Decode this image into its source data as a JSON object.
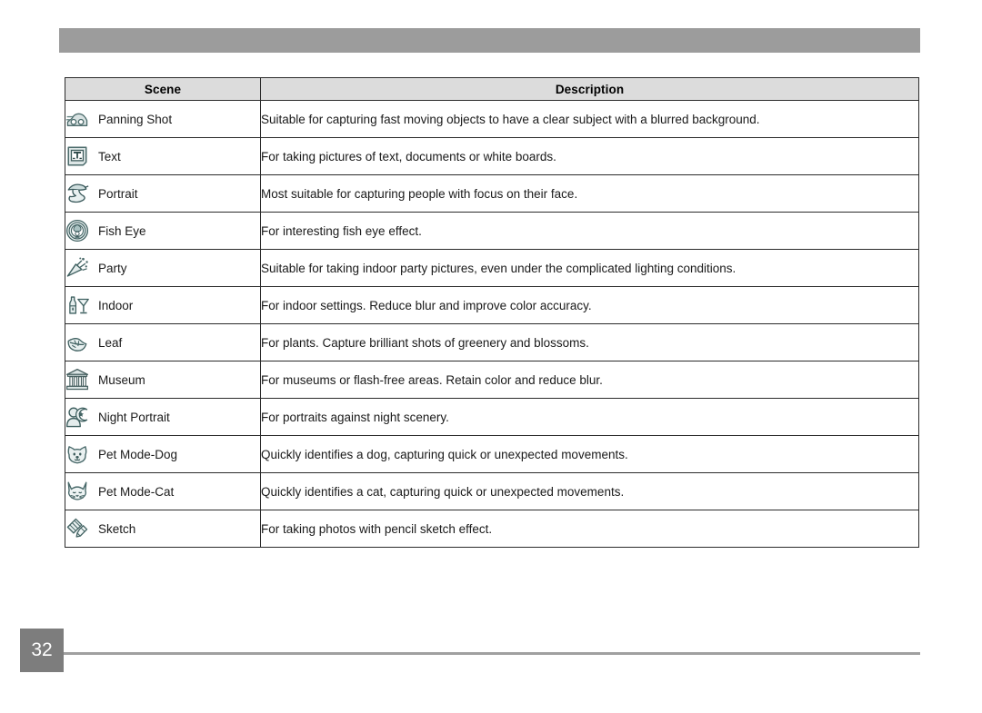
{
  "page": {
    "number": "32",
    "header_bar_color": "#9c9c9c",
    "footer_box_color": "#7d7d7d",
    "footer_rule_color": "#a0a0a0"
  },
  "table": {
    "headers": {
      "scene": "Scene",
      "description": "Description"
    },
    "header_background": "#dcdcdc",
    "border_color": "#2b2b2b",
    "rows": [
      {
        "icon": "panning-shot-icon",
        "scene": "Panning Shot",
        "description": "Suitable for capturing fast moving objects to have a clear subject with a blurred background."
      },
      {
        "icon": "text-icon",
        "scene": "Text",
        "description": "For taking pictures of text, documents or white boards."
      },
      {
        "icon": "portrait-icon",
        "scene": "Portrait",
        "description": "Most suitable for capturing people with focus on their face."
      },
      {
        "icon": "fish-eye-icon",
        "scene": "Fish Eye",
        "description": "For interesting fish eye effect."
      },
      {
        "icon": "party-icon",
        "scene": "Party",
        "description": "Suitable for taking indoor party pictures, even under the complicated lighting conditions."
      },
      {
        "icon": "indoor-icon",
        "scene": "Indoor",
        "description": "For indoor settings. Reduce blur and improve color accuracy."
      },
      {
        "icon": "leaf-icon",
        "scene": "Leaf",
        "description": "For plants. Capture brilliant shots of greenery and blossoms."
      },
      {
        "icon": "museum-icon",
        "scene": "Museum",
        "description": "For museums or flash-free areas. Retain color and reduce blur."
      },
      {
        "icon": "night-portrait-icon",
        "scene": "Night Portrait",
        "description": "For portraits against night scenery."
      },
      {
        "icon": "pet-dog-icon",
        "scene": "Pet Mode-Dog",
        "description": "Quickly identifies a dog, capturing quick or unexpected movements."
      },
      {
        "icon": "pet-cat-icon",
        "scene": "Pet Mode-Cat",
        "description": "Quickly identifies a cat, capturing quick or unexpected movements."
      },
      {
        "icon": "sketch-icon",
        "scene": "Sketch",
        "description": "For taking photos with pencil sketch effect."
      }
    ]
  }
}
